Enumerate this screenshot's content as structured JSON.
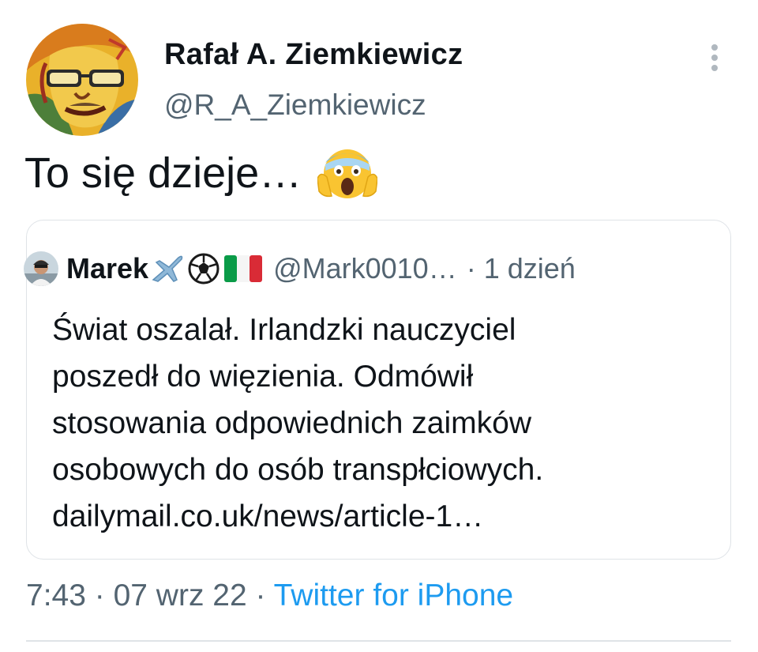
{
  "author": {
    "display_name": "Rafał A. Ziemkiewicz",
    "handle": "@R_A_Ziemkiewicz",
    "avatar_icon": "illustrated-portrait-avatar"
  },
  "tweet": {
    "text": "To się dzieje…",
    "emoji_icon": "face-screaming-in-fear-icon"
  },
  "quoted_tweet": {
    "display_name": "Marek",
    "name_emojis": [
      "airplane-icon",
      "soccer-ball-icon",
      "italy-flag-icon"
    ],
    "handle": "@Mark0010…",
    "separator": "·",
    "time": "1 dzień",
    "lines": [
      "Świat oszalał. Irlandzki nauczyciel",
      "poszedł do więzienia. Odmówił",
      "stosowania odpowiednich zaimków",
      "osobowych do osób transpłciowych.",
      "dailymail.co.uk/news/article-1…"
    ]
  },
  "meta": {
    "time": "7:43",
    "sep1": " · ",
    "date": "07 wrz 22",
    "sep2": " · ",
    "source": "Twitter for iPhone"
  },
  "colors": {
    "text": "#0f1419",
    "secondary": "#536471",
    "link": "#1d9bf0",
    "border": "#dfe3e7"
  }
}
